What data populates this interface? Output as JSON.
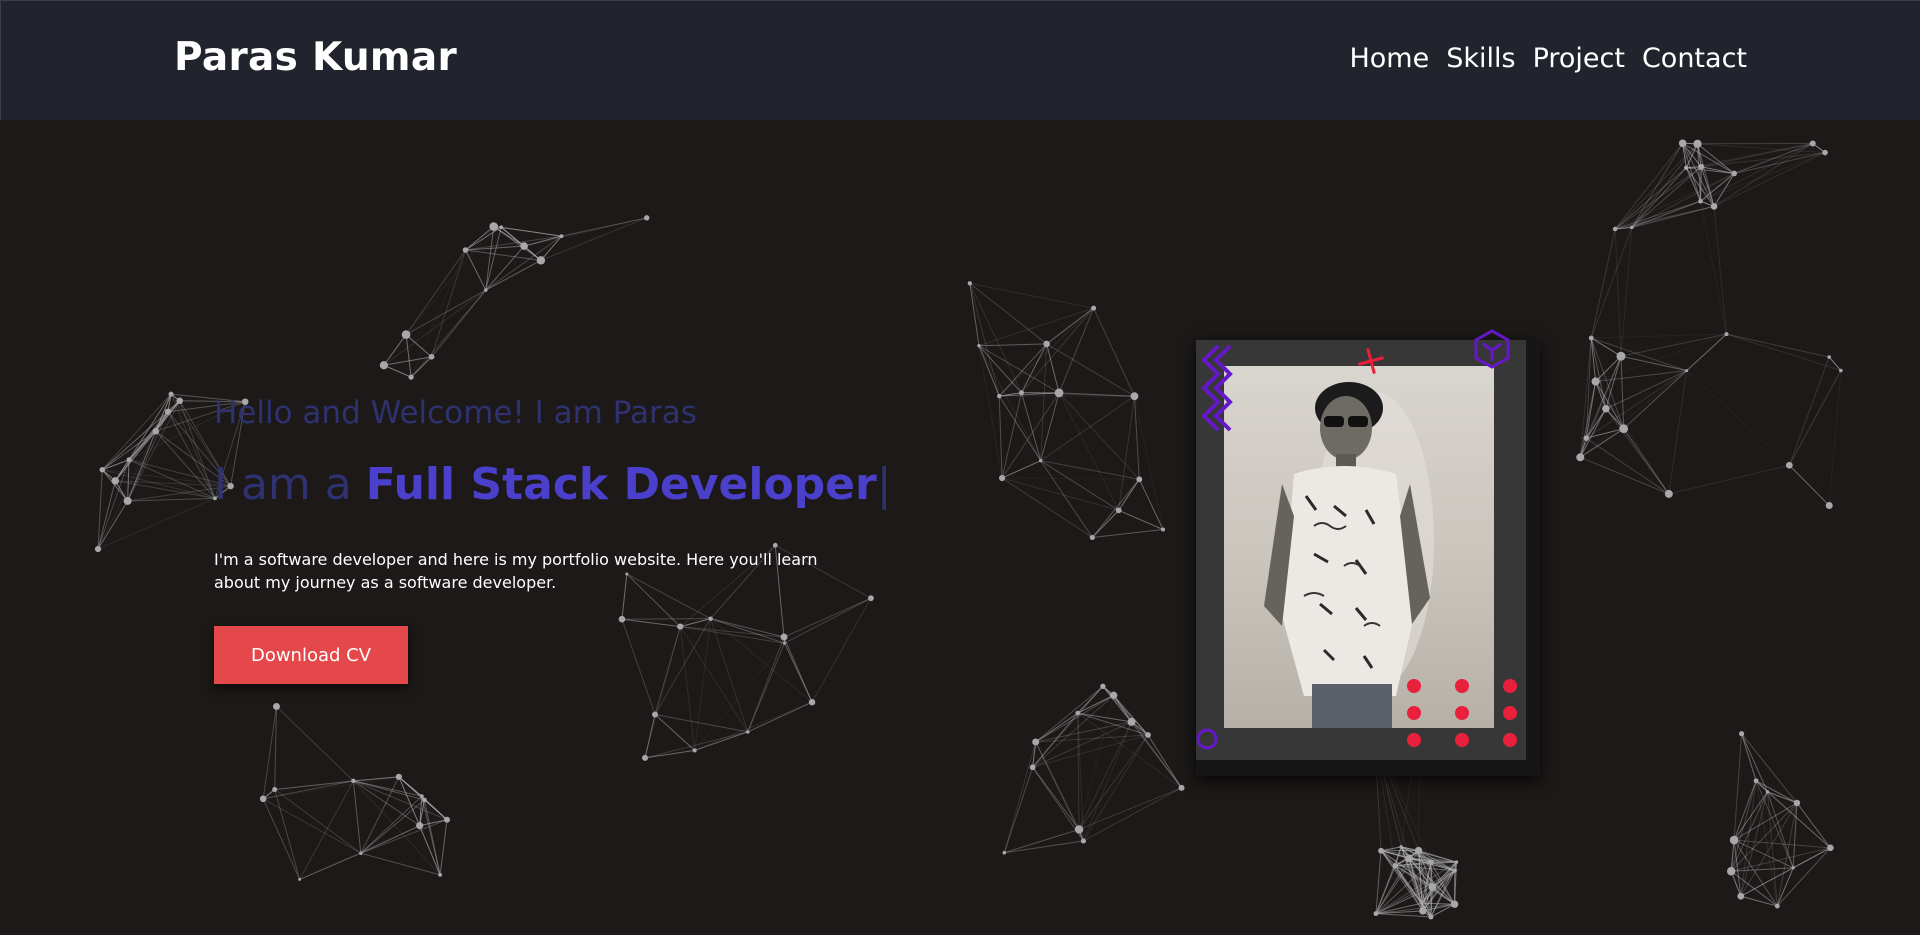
{
  "navbar": {
    "brand": "Paras Kumar",
    "links": [
      "Home",
      "Skills",
      "Project",
      "Contact"
    ]
  },
  "hero": {
    "greeting": "Hello and Welcome! I am Paras",
    "role_prefix": "I am a ",
    "role_main": "Full Stack Developer",
    "cursor": "|",
    "intro": "I'm a software developer and here is my portfolio website. Here you'll learn about my journey as a software developer.",
    "cv_button": "Download CV"
  },
  "colors": {
    "background": "#1c1918",
    "navbar": "#21242d",
    "accent_purple": "#4b40cc",
    "muted_purple": "#2e3270",
    "button_red": "#e5484a",
    "deco_red": "#e8203c",
    "deco_violet": "#6418c9"
  },
  "icons": {
    "zigzag": "zigzag-icon",
    "cross": "cross-icon",
    "hexagon": "hexagon-icon",
    "circle": "circle-icon",
    "dots": "dot-grid-icon"
  }
}
